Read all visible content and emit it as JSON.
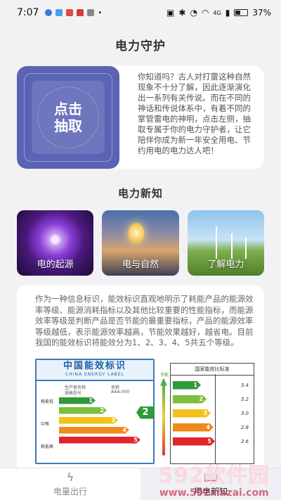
{
  "status": {
    "time": "7:07",
    "battery": "37%",
    "signal": "4G"
  },
  "page": {
    "title": "电力守护"
  },
  "intro": {
    "draw_button": "点击抽取",
    "text": "你知道吗？古人对打雷这种自然现象不十分了解，因此逐渐演化出一系列有关传说。而在不同的神话和传说体系中，有着不同的掌管雷电的神明，点击左侧，抽取专属于你的电力守护者，让它陪伴你成为新一年安全用电、节约用电的电力达人吧！"
  },
  "knowledge": {
    "title": "电力新知",
    "tiles": [
      {
        "label": "电的起源"
      },
      {
        "label": "电与自然"
      },
      {
        "label": "了解电力"
      }
    ]
  },
  "article": {
    "text": "作为一种信息标识，能效标识直观地明示了耗能产品的能源效率等级、能源消耗指标以及其他比较重要的性能指标，而能源效率等级是判断产品是否节能的最重要指标，产品的能源效率等级越低，表示能源效率越高，节能效果越好，越省电。目前我国的能效标识将能效分为1、2、3、4、5共五个等级。",
    "energy_label": {
      "title": "中国能效标识",
      "subtitle": "CHINA ENERGY LABEL",
      "producer_label": "生产者名称",
      "producer_value": "名称",
      "model_label": "规格型号",
      "model_value": "AAA-000",
      "side_low": "耗能低",
      "side_mid": "中等",
      "side_high": "耗能高",
      "grades": [
        "1",
        "2",
        "3",
        "4",
        "5"
      ],
      "grade_colors": [
        "#2f9a3b",
        "#7cbf3a",
        "#f2c21b",
        "#f08a1c",
        "#e0262b"
      ],
      "rating": "2"
    },
    "comparison": {
      "title": "国家能效比标准",
      "arrow_top": "节能",
      "grades": [
        "1",
        "2",
        "3",
        "4",
        "5"
      ],
      "values": [
        "3.4",
        "3.2",
        "3.0",
        "2.8",
        "2.6"
      ]
    }
  },
  "tabbar": {
    "tabs": [
      {
        "label": "电量出行",
        "icon": "lightning-icon",
        "active": false
      },
      {
        "label": "用电新知",
        "icon": "book-icon",
        "active": true
      }
    ]
  },
  "watermark": {
    "logo": "592软件园",
    "url": "www.592xiazai.com"
  }
}
